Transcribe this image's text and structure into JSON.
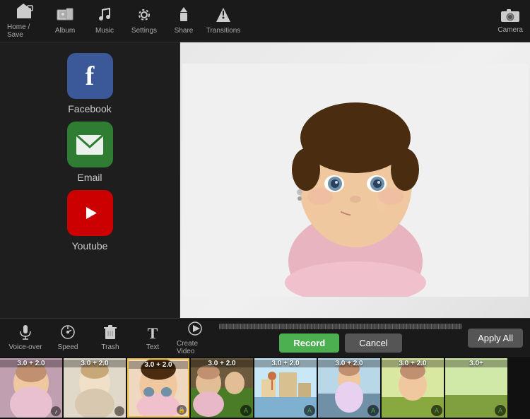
{
  "toolbar": {
    "items": [
      {
        "id": "home-save",
        "label": "Home / Save",
        "icon": "🏠"
      },
      {
        "id": "album",
        "label": "Album",
        "icon": "📷"
      },
      {
        "id": "music",
        "label": "Music",
        "icon": "♪"
      },
      {
        "id": "settings",
        "label": "Settings",
        "icon": "⚙"
      },
      {
        "id": "share",
        "label": "Share",
        "icon": "📤"
      },
      {
        "id": "transitions",
        "label": "Transitions",
        "icon": "⚡"
      }
    ],
    "camera_label": "Camera",
    "camera_icon": "📷"
  },
  "social_panel": {
    "items": [
      {
        "id": "facebook",
        "label": "Facebook",
        "type": "facebook",
        "icon": "f"
      },
      {
        "id": "email",
        "label": "Email",
        "type": "email",
        "icon": "✉"
      },
      {
        "id": "youtube",
        "label": "Youtube",
        "type": "youtube",
        "icon": "▶"
      }
    ]
  },
  "controls": {
    "items": [
      {
        "id": "voice-over",
        "label": "Voice-over",
        "icon": "🎤"
      },
      {
        "id": "speed",
        "label": "Speed",
        "icon": "⏱"
      },
      {
        "id": "trash",
        "label": "Trash",
        "icon": "🗑"
      },
      {
        "id": "text",
        "label": "Text",
        "icon": "T"
      },
      {
        "id": "create-video",
        "label": "Create Video",
        "icon": "▷"
      }
    ],
    "record_label": "Record",
    "cancel_label": "Cancel",
    "apply_all_label": "Apply All"
  },
  "filmstrip": {
    "items": [
      {
        "id": 1,
        "label": "3.0 + 2.0",
        "active": false,
        "badge": "♪",
        "theme": "t1"
      },
      {
        "id": 2,
        "label": "3.0 + 2.0",
        "active": false,
        "badge": "-",
        "theme": "t2"
      },
      {
        "id": 3,
        "label": "3.0 + 2.0",
        "active": true,
        "badge": "🔒",
        "theme": "t3"
      },
      {
        "id": 4,
        "label": "3.0 + 2.0",
        "active": false,
        "badge": "A",
        "theme": "t4"
      },
      {
        "id": 5,
        "label": "3.0 + 2.0",
        "active": false,
        "badge": "A",
        "theme": "t5"
      },
      {
        "id": 6,
        "label": "3.0 + 2.0",
        "active": false,
        "badge": "A",
        "theme": "t6"
      },
      {
        "id": 7,
        "label": "3.0 + 2.0",
        "active": false,
        "badge": "A",
        "theme": "t7"
      },
      {
        "id": 8,
        "label": "3.0+",
        "active": false,
        "badge": "A",
        "theme": "t8"
      }
    ]
  },
  "colors": {
    "accent_green": "#4CAF50",
    "facebook_blue": "#3b5998",
    "email_green": "#2e7d32",
    "youtube_red": "#cc0000"
  }
}
